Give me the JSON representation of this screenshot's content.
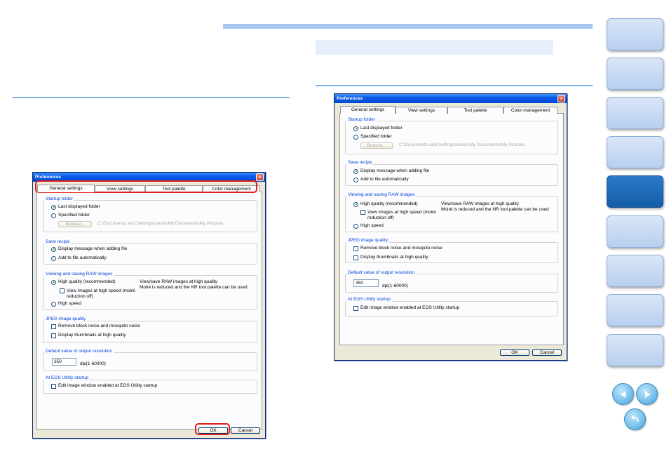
{
  "dialog": {
    "title": "Preferences",
    "close_glyph": "×",
    "tabs": [
      "General settings",
      "View settings",
      "Tool palette",
      "Color management"
    ],
    "startup_folder": {
      "title": "Startup folder",
      "options": [
        "Last displayed folder",
        "Specified folder"
      ],
      "browse_label": "Browse...",
      "path": "C:\\Documents and Settings\\canon\\My Documents\\My Pictures"
    },
    "save_recipe": {
      "title": "Save recipe",
      "options": [
        "Display message when adding file",
        "Add to file automatically"
      ]
    },
    "raw": {
      "title": "Viewing and saving RAW images",
      "high_quality": "High quality (recommended)",
      "view_high_speed": "View images at high speed (moiré reduction off)",
      "high_speed": "High speed",
      "description_line1": "View/save RAW images at high quality",
      "description_line2": "Moiré is reduced and the NR tool palette can be used"
    },
    "jpeg": {
      "title": "JPEG image quality",
      "options": [
        "Remove block noise and mosquito noise",
        "Display thumbnails at high quality"
      ]
    },
    "resolution": {
      "title": "Default value of output resolution",
      "value": "350",
      "unit": "dpi(1-60000)"
    },
    "eos": {
      "title": "At EOS Utility startup",
      "option": "Edit image window enabled at EOS Utility startup"
    },
    "ok_label": "OK",
    "cancel_label": "Cancel"
  },
  "colors": {
    "accent": "#a6c7f0",
    "rule": "#7fb0ea",
    "highlight": "#e0201b",
    "active_tab": "#1a66b3"
  },
  "side_nav": {
    "tab_count": 9,
    "active_index": 4
  },
  "icons": [
    "previous-page-icon",
    "next-page-icon",
    "return-icon"
  ]
}
